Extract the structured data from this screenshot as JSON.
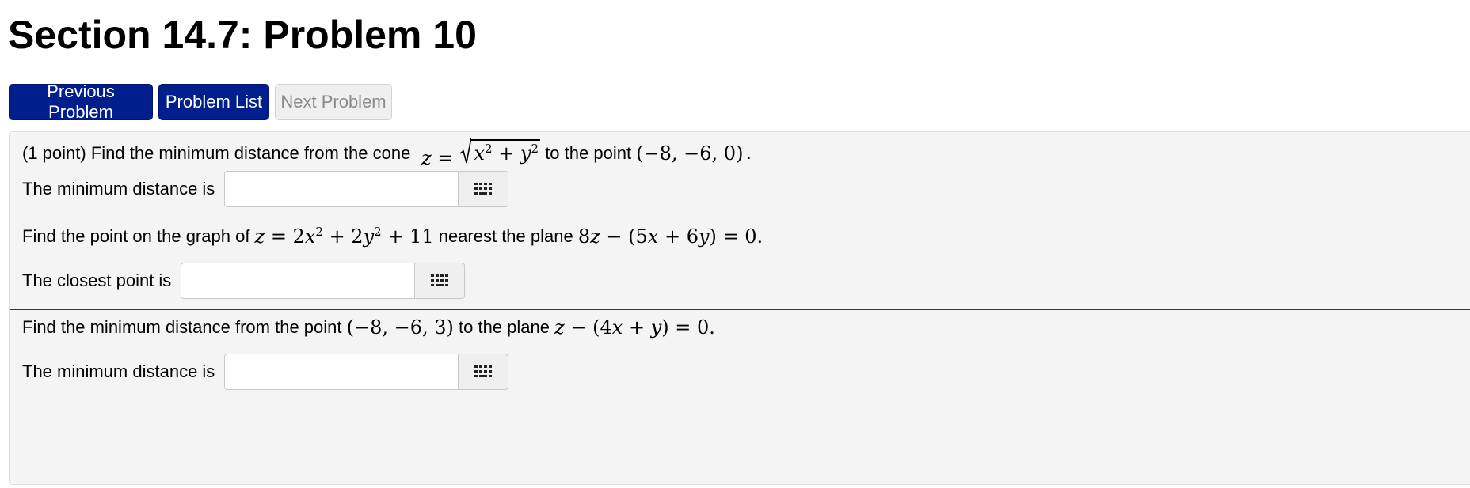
{
  "page": {
    "title": "Section 14.7: Problem 10"
  },
  "nav": {
    "previous_label": "Previous Problem",
    "list_label": "Problem List",
    "next_label": "Next Problem"
  },
  "part1": {
    "prefix": "(1 point) Find the minimum distance from the cone ",
    "middle": " to the point ",
    "suffix": ".",
    "answer_label": "The minimum distance is",
    "answer_value": ""
  },
  "part2": {
    "prefix": "Find the point on the graph of ",
    "middle": " nearest the plane ",
    "answer_label": "The closest point is",
    "answer_value": ""
  },
  "part3": {
    "prefix": "Find the minimum distance from the point ",
    "middle": " to the plane ",
    "answer_label": "The minimum distance is",
    "answer_value": ""
  },
  "icons": {
    "equation_editor": "keypad-grid-icon"
  }
}
